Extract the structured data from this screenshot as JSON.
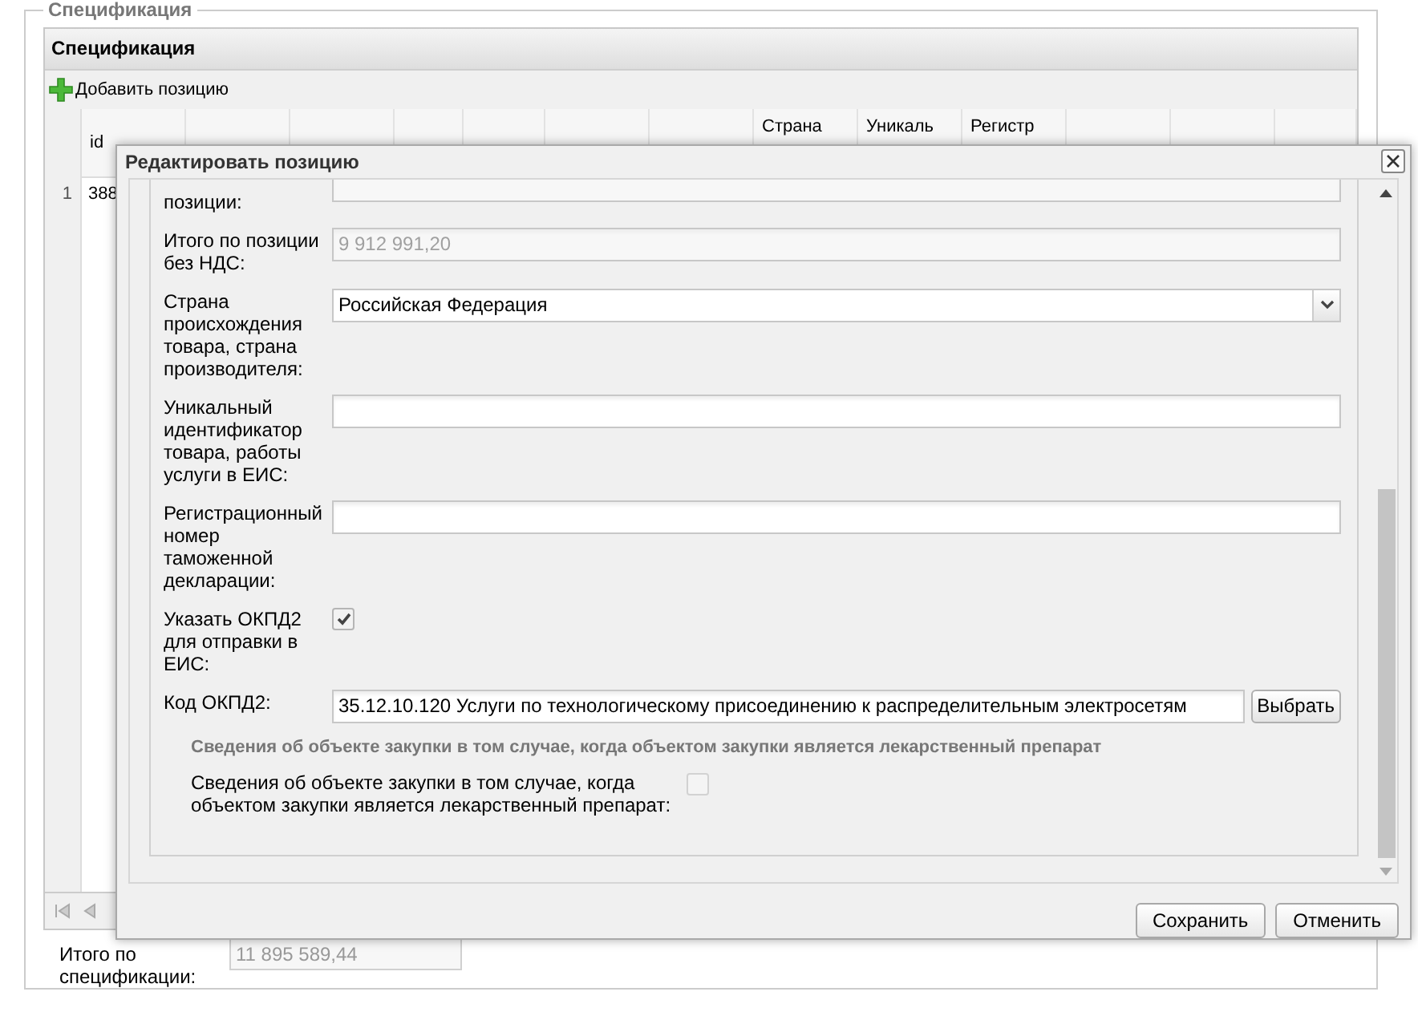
{
  "background": {
    "legend": "Спецификация",
    "panel_title": "Спецификация",
    "add_button": "Добавить позицию",
    "columns": [
      {
        "label": "id"
      },
      {},
      {},
      {},
      {},
      {},
      {},
      {
        "label": "Страна"
      },
      {
        "label": "Уникаль"
      },
      {
        "label": "Регистр"
      },
      {},
      {},
      {}
    ],
    "rows": [
      {
        "number": "1",
        "id": "388"
      }
    ],
    "total": {
      "label": "Итого по спецификации:",
      "value": "11 895 589,44",
      "disabled": true
    }
  },
  "modal": {
    "title": "Редактировать позицию",
    "fields": [
      {
        "kind": "cut_text",
        "label": "позиции:"
      },
      {
        "kind": "text",
        "label": "Итого по позиции без НДС:",
        "value": "9 912 991,20",
        "disabled": true
      },
      {
        "kind": "combo",
        "label": "Страна происхождения товара, страна производителя:",
        "value": "Российская Федерация"
      },
      {
        "kind": "text",
        "label": "Уникальный идентификатор товара, работы услуги в ЕИС:"
      },
      {
        "kind": "text",
        "label": "Регистрационный номер таможенной декларации:"
      },
      {
        "kind": "checkbox",
        "label": "Указать ОКПД2 для отправки в ЕИС:",
        "checked": true
      },
      {
        "kind": "picker",
        "label": "Код ОКПД2:",
        "value": "35.12.10.120 Услуги по технологическому присоединению к распределительным электросетям",
        "button": "Выбрать"
      }
    ],
    "section_title": "Сведения об объекте закупки в том случае, когда объектом закупки является лекарственный препарат",
    "drug": {
      "label": "Сведения об объекте закупки в том случае, когда объектом закупки является лекарственный препарат:",
      "checked": false,
      "disabled": true
    },
    "buttons": [
      {
        "label": "Сохранить"
      },
      {
        "label": "Отменить"
      }
    ]
  }
}
